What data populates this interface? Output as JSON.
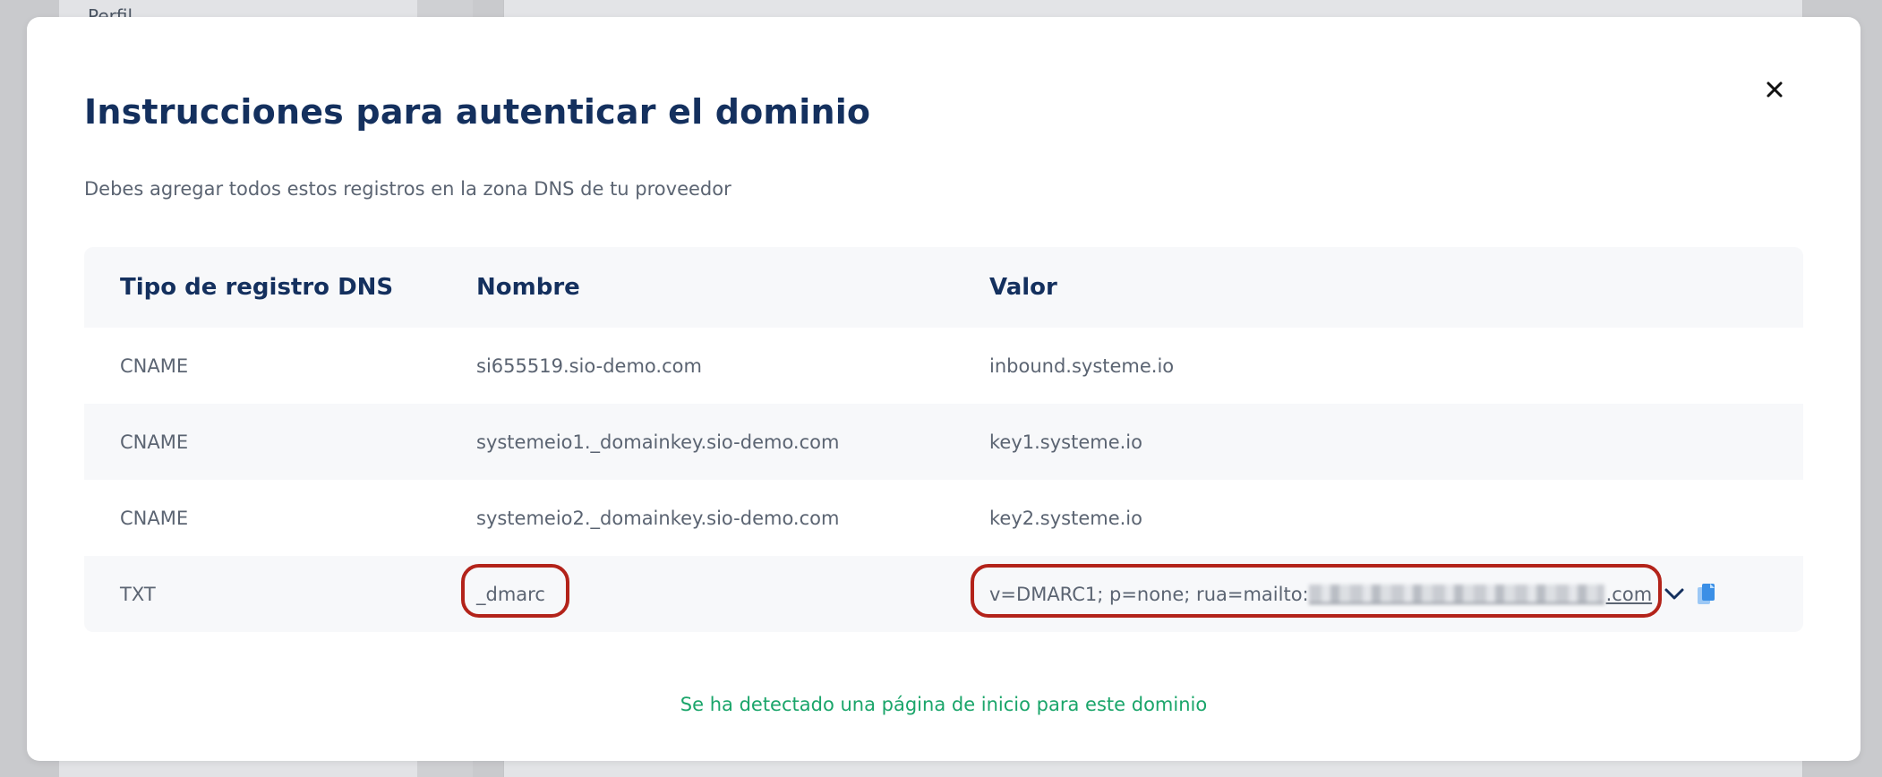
{
  "background": {
    "sidebar_label": "Perfil"
  },
  "modal": {
    "title": "Instrucciones para autenticar el dominio",
    "close_icon": "close-icon",
    "subtitle": "Debes agregar todos estos registros en la zona DNS de tu proveedor",
    "status_message": "Se ha detectado una página de inicio para este dominio",
    "status_color": "#1aa56a",
    "highlight_color": "#b3231a",
    "title_color": "#14305e"
  },
  "table": {
    "headers": [
      "Tipo de registro DNS",
      "Nombre",
      "Valor"
    ],
    "rows": [
      {
        "type": "CNAME",
        "name": "si655519.sio-demo.com",
        "value": "inbound.systeme.io"
      },
      {
        "type": "CNAME",
        "name": "systemeio1._domainkey.sio-demo.com",
        "value": "key1.systeme.io"
      },
      {
        "type": "CNAME",
        "name": "systemeio2._domainkey.sio-demo.com",
        "value": "key2.systeme.io"
      },
      {
        "type": "TXT",
        "name": "_dmarc",
        "value_prefix": "v=DMARC1; p=none; rua=mailto:",
        "value_suffix": ".com",
        "expand_icon": "chevron-down-icon",
        "copy_icon": "copy-icon"
      }
    ]
  }
}
